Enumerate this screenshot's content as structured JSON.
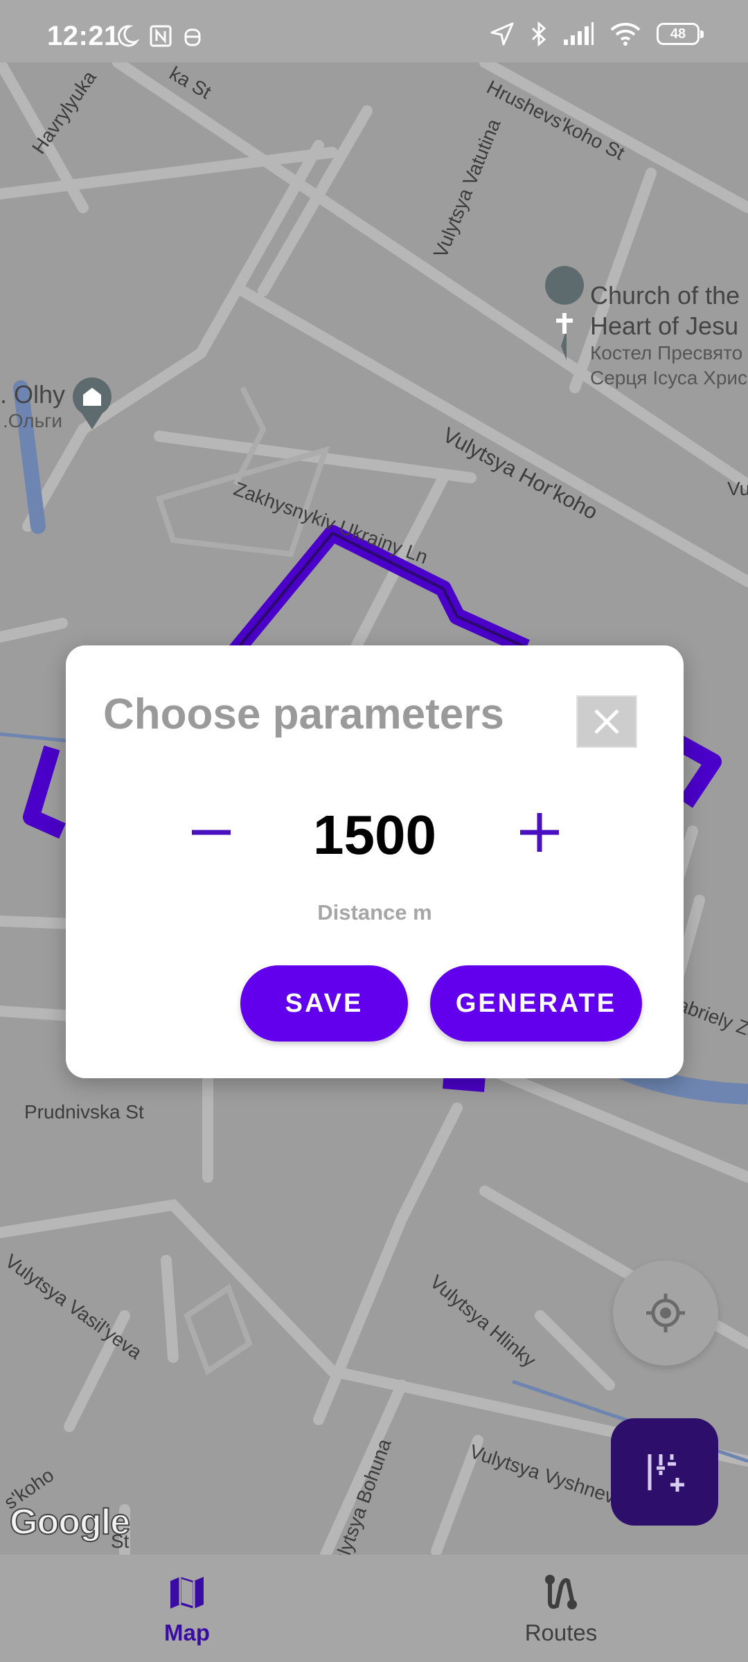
{
  "status_bar": {
    "time": "12:21",
    "battery": "48",
    "icons": [
      "moon-icon",
      "nfc-icon",
      "robot-icon",
      "location-arrow-icon",
      "bluetooth-icon",
      "signal-icon",
      "wifi-icon",
      "battery-icon"
    ]
  },
  "map": {
    "streets": [
      "Havrylyuka",
      "ka St",
      "Hrushevs'koho St",
      "Vulytsya Vatutina",
      "Vulytsya Hor'koho",
      "Zakhysnykiv Ukrainy Ln",
      "Prudnivska St",
      "Vulytsya Vasil'yeva",
      "Vulytsya Hlinky",
      "Vulytsya Bohuna",
      "Vulytsya Vyshneva",
      "abriely Za",
      "Vu",
      "s'koho",
      "St"
    ],
    "poi_church": {
      "name_line1": "Church of the",
      "name_line2": "Heart of Jesu",
      "local_line1": "Костел Пресвято",
      "local_line2": "Серця Ісуса Хрис"
    },
    "poi_olhy": {
      "name": ". Olhy",
      "local": ".Ольги"
    },
    "attribution": "Google",
    "route_color": "#4a00c8"
  },
  "dialog": {
    "title": "Choose parameters",
    "value": "1500",
    "caption": "Distance m",
    "save_label": "SAVE",
    "generate_label": "GENERATE",
    "accent": "#6200ee"
  },
  "bottom_nav": {
    "items": [
      {
        "label": "Map",
        "icon": "map-icon",
        "active": true
      },
      {
        "label": "Routes",
        "icon": "route-icon",
        "active": false
      }
    ],
    "active_color": "#3a0ca3"
  }
}
